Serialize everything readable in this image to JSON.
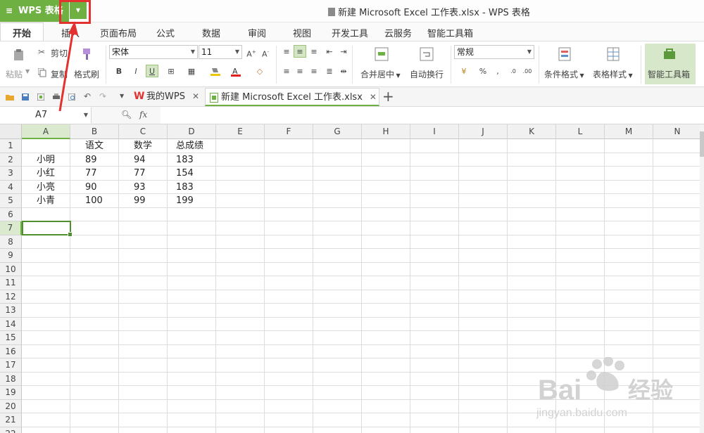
{
  "app": {
    "button_label": "WPS 表格",
    "logo_glyph": "≡",
    "window_title": "新建 Microsoft Excel 工作表.xlsx - WPS 表格"
  },
  "ribbon_tabs": [
    "开始",
    "插入",
    "页面布局",
    "公式",
    "数据",
    "审阅",
    "视图",
    "开发工具",
    "云服务",
    "智能工具箱"
  ],
  "ribbon": {
    "paste_label": "粘贴",
    "cut_label": "剪切",
    "copy_label": "复制",
    "format_painter_label": "格式刷",
    "font_name": "宋体",
    "font_size": "11",
    "bold": "B",
    "italic": "I",
    "underline": "U",
    "merge_label": "合并居中",
    "wrap_label": "自动换行",
    "number_format": "常规",
    "percent": "%",
    "comma": ",",
    "conditional_format_label": "条件格式",
    "table_style_label": "表格样式",
    "smart_toolbox_label": "智能工具箱"
  },
  "doc_tabs": [
    {
      "label": "我的WPS",
      "active": false
    },
    {
      "label": "新建 Microsoft Excel 工作表.xlsx",
      "active": true
    }
  ],
  "formula_bar": {
    "cell_ref": "A7",
    "fx_label": "fx",
    "content": ""
  },
  "sheet": {
    "columns": [
      "A",
      "B",
      "C",
      "D",
      "E",
      "F",
      "G",
      "H",
      "I",
      "J",
      "K",
      "L",
      "M",
      "N"
    ],
    "selected_column": "A",
    "selected_row": 7,
    "row_count": 22,
    "rows": [
      [
        "",
        "语文",
        "数学",
        "总成绩"
      ],
      [
        "小明",
        "89",
        "94",
        "183"
      ],
      [
        "小红",
        "77",
        "77",
        "154"
      ],
      [
        "小亮",
        "90",
        "93",
        "183"
      ],
      [
        "小青",
        "100",
        "99",
        "199"
      ]
    ]
  },
  "watermark": {
    "text1": "Bai",
    "text2": "经验",
    "url": "jingyan.baidu.com"
  },
  "colors": {
    "accent": "#6fb043",
    "annotation": "#e3312f"
  }
}
